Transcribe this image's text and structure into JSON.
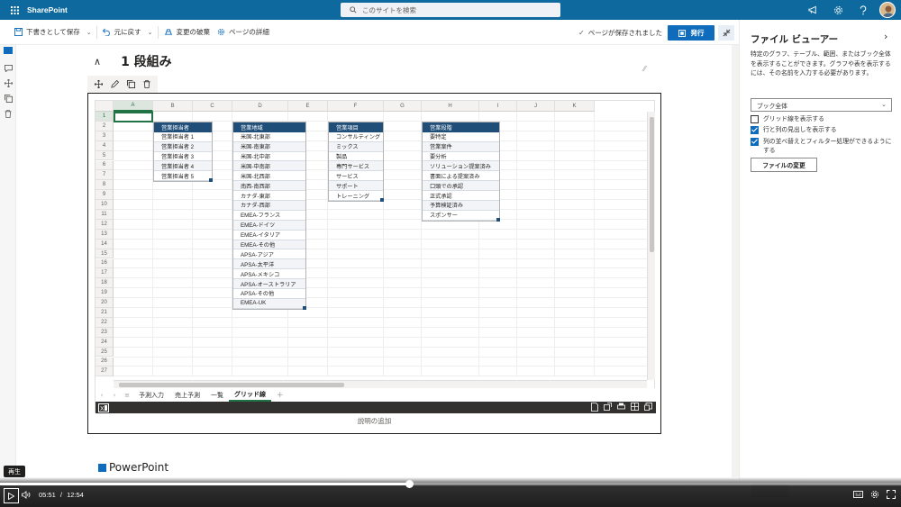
{
  "suite": {
    "brand": "SharePoint",
    "search_placeholder": "このサイトを検索"
  },
  "toolbar": {
    "save_draft": "下書きとして保存",
    "undo": "元に戻す",
    "discard": "変更の破棄",
    "page_details": "ページの詳細",
    "saved_status": "ページが保存されました",
    "publish": "発行"
  },
  "section": {
    "heading": "1 段組み"
  },
  "excel": {
    "columns": [
      "A",
      "B",
      "C",
      "D",
      "E",
      "F",
      "G",
      "H",
      "I",
      "J",
      "K"
    ],
    "rows": [
      "1",
      "2",
      "3",
      "4",
      "5",
      "6",
      "7",
      "8",
      "9",
      "10",
      "11",
      "12",
      "13",
      "14",
      "15",
      "16",
      "17",
      "18",
      "19",
      "20",
      "21",
      "22",
      "23",
      "24",
      "25",
      "26",
      "27"
    ],
    "tables": [
      {
        "header": "営業担当者",
        "items": [
          "営業担当者 1",
          "営業担当者 2",
          "営業担当者 3",
          "営業担当者 4",
          "営業担当者 5"
        ]
      },
      {
        "header": "営業地域",
        "items": [
          "米国-北東部",
          "米国-南東部",
          "米国-北中部",
          "米国-中南部",
          "米国-北西部",
          "南西-南西部",
          "カナダ-東部",
          "カナダ-西部",
          "EMEA-フランス",
          "EMEA-ドイツ",
          "EMEA-イタリア",
          "EMEA-その他",
          "APSA-アジア",
          "APSA-太平洋",
          "APSA-メキシコ",
          "APSA-オーストラリア",
          "APSA-その他",
          "EMEA-UK"
        ]
      },
      {
        "header": "営業項目",
        "items": [
          "コンサルティング",
          "ミックス",
          "製品",
          "専門サービス",
          "サービス",
          "サポート",
          "トレーニング"
        ]
      },
      {
        "header": "営業段階",
        "items": [
          "要特定",
          "営業案件",
          "要分析",
          "ソリューション提案済み",
          "書面による提案済み",
          "口頭での承認",
          "正式承認",
          "予算検証済み",
          "スポンサー"
        ]
      }
    ],
    "sheet_tabs": [
      "予測入力",
      "売上予測",
      "一覧",
      "グリッド線"
    ],
    "active_tab": "グリッド線",
    "caption": "説明の追加"
  },
  "next_section": {
    "title": "PowerPoint"
  },
  "panel": {
    "title": "ファイル ビューアー",
    "description": "特定のグラフ、テーブル、範囲、またはブック全体を表示することができます。グラフや表を表示するには、その名前を入力する必要があります。",
    "dropdown_value": "ブック全体",
    "checkboxes": [
      {
        "label": "グリッド線を表示する",
        "checked": false
      },
      {
        "label": "行と列の見出しを表示する",
        "checked": true
      },
      {
        "label": "列の並べ替えとフィルター処理ができるようにする",
        "checked": true
      }
    ],
    "change_file": "ファイルの変更"
  },
  "player": {
    "tooltip": "再生",
    "current_time": "05:51",
    "separator": "/",
    "duration": "12:54",
    "progress": 0.454
  },
  "colors": {
    "suite": "#0e6a9e",
    "accent": "#0f6cbd",
    "table_header": "#1f4e79",
    "excel_green": "#217346"
  }
}
